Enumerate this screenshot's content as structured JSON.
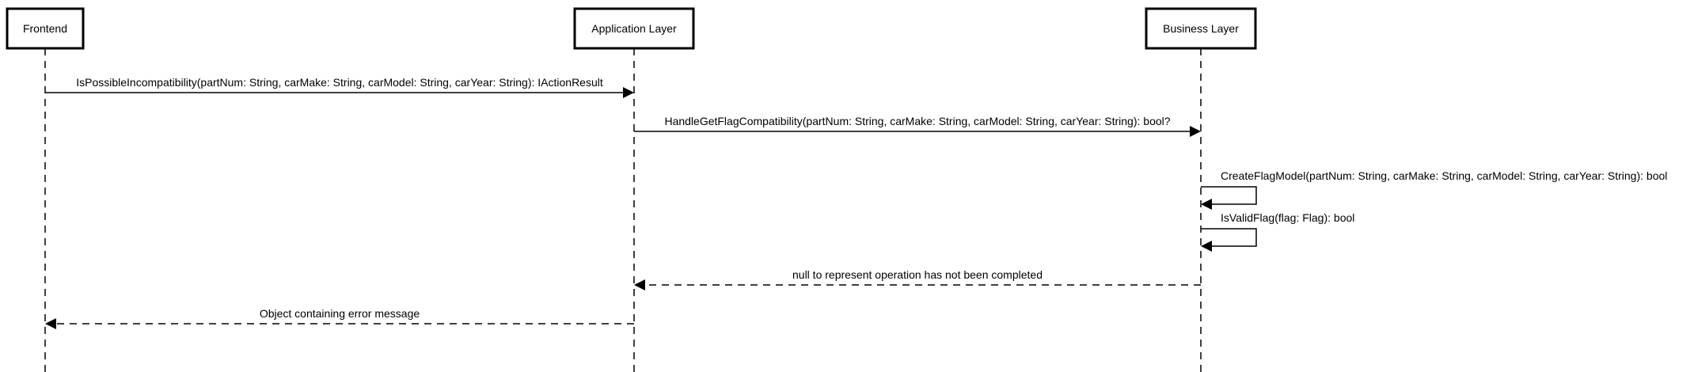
{
  "participants": [
    {
      "id": "frontend",
      "label": "Frontend"
    },
    {
      "id": "app",
      "label": "Application Layer"
    },
    {
      "id": "business",
      "label": "Business Layer"
    }
  ],
  "messages": [
    {
      "from": "frontend",
      "to": "app",
      "label": "IsPossibleIncompatibility(partNum: String, carMake: String, carModel: String, carYear: String): IActionResult",
      "style": "solid"
    },
    {
      "from": "app",
      "to": "business",
      "label": "HandleGetFlagCompatibility(partNum: String, carMake: String, carModel: String, carYear: String): bool?",
      "style": "solid"
    },
    {
      "from": "business",
      "to": "business",
      "label": "CreateFlagModel(partNum: String, carMake: String, carModel: String, carYear: String): bool",
      "style": "solid"
    },
    {
      "from": "business",
      "to": "business",
      "label": "IsValidFlag(flag: Flag): bool",
      "style": "solid"
    },
    {
      "from": "business",
      "to": "app",
      "label": "null to represent operation has not been completed",
      "style": "dashed"
    },
    {
      "from": "app",
      "to": "frontend",
      "label": "Object containing error message",
      "style": "dashed"
    }
  ]
}
